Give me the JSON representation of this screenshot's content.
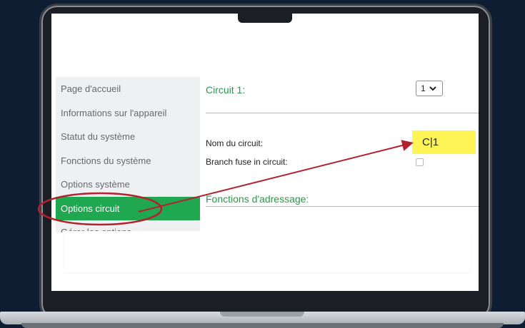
{
  "sidebar": {
    "items": [
      {
        "label": "Page d'accueil"
      },
      {
        "label": "Informations sur l'appareil"
      },
      {
        "label": "Statut du système"
      },
      {
        "label": "Fonctions du système"
      },
      {
        "label": "Options système"
      },
      {
        "label": "Options circuit",
        "active": true
      },
      {
        "label": "Gérer les options"
      }
    ]
  },
  "main": {
    "circuit_title": "Circuit 1:",
    "circuit_select": {
      "value": "1",
      "options": [
        "1"
      ]
    },
    "name_label": "Nom du circuit:",
    "name_value": "C|1",
    "branch_fuse_label": "Branch fuse in circuit:",
    "branch_fuse_checked": false,
    "addressing_title": "Fonctions d'adressage:"
  },
  "annotation": {
    "color": "#b3202e",
    "highlight_color": "#fff455"
  },
  "colors": {
    "accent_green": "#1fa84f",
    "background": "#0f1d33"
  },
  "icons": [
    "chevron-down-icon"
  ]
}
